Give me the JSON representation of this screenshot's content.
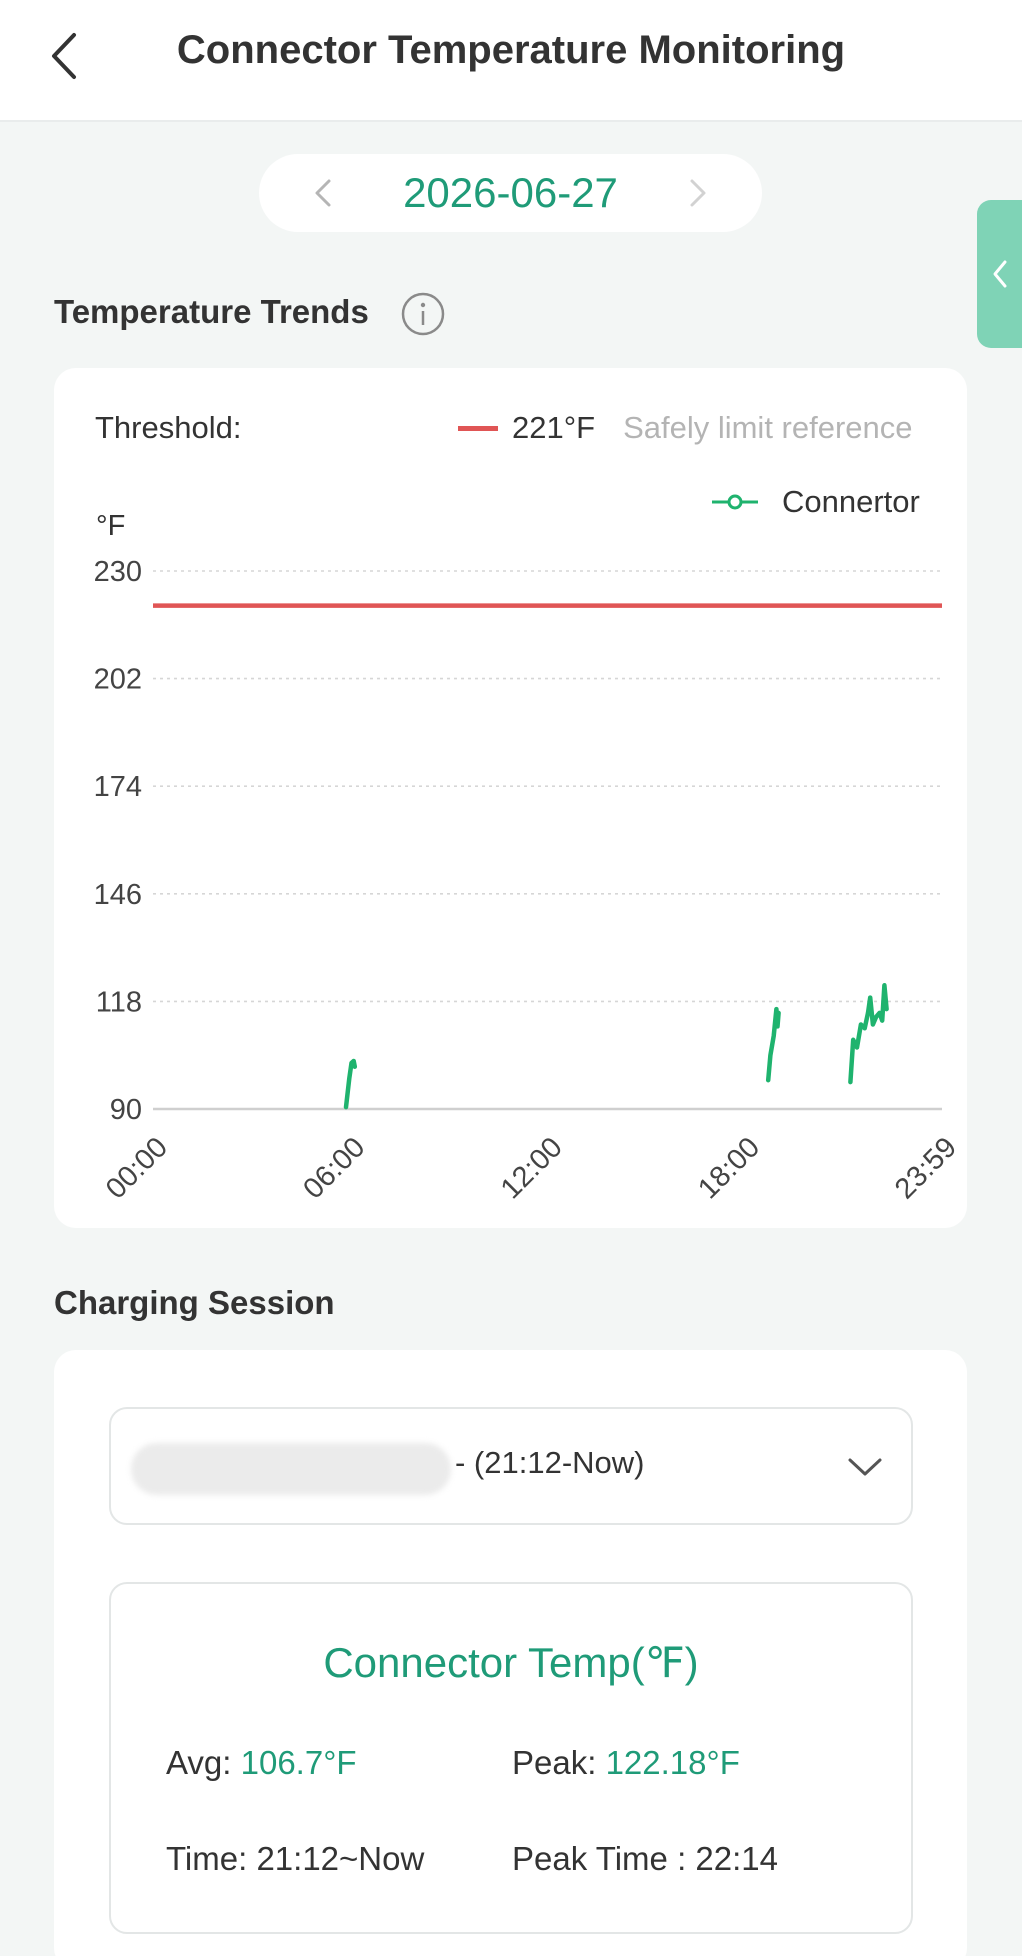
{
  "header": {
    "title": "Connector Temperature Monitoring"
  },
  "date_picker": {
    "date": "2026-06-27"
  },
  "trends": {
    "section_title": "Temperature Trends",
    "threshold_label": "Threshold:",
    "threshold_value": "221°F",
    "threshold_note": "Safely limit reference",
    "series_legend": "Connertor",
    "threshold_color": "#e05555",
    "series_color": "#1fb36e"
  },
  "chart_data": {
    "type": "line",
    "ylabel": "°F",
    "ylim": [
      90,
      230
    ],
    "y_ticks": [
      "230",
      "202",
      "174",
      "146",
      "118",
      "90"
    ],
    "x_ticks": [
      "00:00",
      "06:00",
      "12:00",
      "18:00",
      "23:59"
    ],
    "threshold": 221,
    "grid": true,
    "legend_position": "top-right",
    "series": [
      {
        "name": "Connertor",
        "segments": [
          [
            [
              "05:52",
              90.5
            ],
            [
              "05:58",
              98
            ],
            [
              "06:02",
              102
            ],
            [
              "06:06",
              102.5
            ],
            [
              "06:08",
              101
            ]
          ],
          [
            [
              "18:42",
              97.5
            ],
            [
              "18:46",
              104
            ],
            [
              "18:52",
              109
            ],
            [
              "18:57",
              116
            ],
            [
              "18:59",
              111.5
            ],
            [
              "19:01",
              115
            ]
          ],
          [
            [
              "21:12",
              97
            ],
            [
              "21:17",
              108
            ],
            [
              "21:24",
              106
            ],
            [
              "21:31",
              112
            ],
            [
              "21:38",
              111
            ],
            [
              "21:44",
              115
            ],
            [
              "21:48",
              119
            ],
            [
              "21:53",
              112
            ],
            [
              "21:59",
              114
            ],
            [
              "22:05",
              115
            ],
            [
              "22:10",
              113
            ],
            [
              "22:14",
              122.18
            ],
            [
              "22:18",
              116
            ]
          ]
        ]
      }
    ]
  },
  "charging": {
    "section_title": "Charging Session",
    "session_label": "- (21:12-Now)",
    "temp_title": "Connector Temp(℉)",
    "avg_label": "Avg: ",
    "avg_value": "106.7°F",
    "peak_label": "Peak: ",
    "peak_value": "122.18°F",
    "time_label": "Time: 21:12~Now",
    "peak_time_label": "Peak Time : 22:14"
  }
}
